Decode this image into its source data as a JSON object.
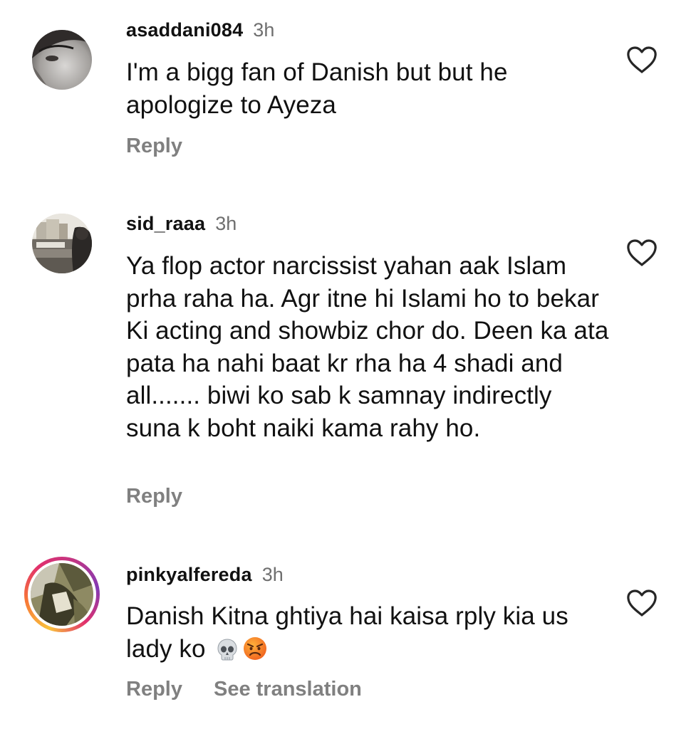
{
  "comments": [
    {
      "username": "asaddani084",
      "time": "3h",
      "text": "I'm a bigg fan of Danish but but he apologize to Ayeza",
      "reply_label": "Reply"
    },
    {
      "username": "sid_raaa",
      "time": "3h",
      "text": "Ya flop actor narcissist yahan aak Islam prha raha ha. Agr itne hi Islami ho to bekar Ki acting and showbiz chor do. Deen ka ata pata ha nahi baat kr rha ha 4 shadi and all....... biwi ko sab k samnay indirectly suna k boht naiki kama rahy ho.",
      "reply_label": "Reply"
    },
    {
      "username": "pinkyalfereda",
      "time": "3h",
      "text": "Danish Kitna ghtiya hai kaisa rply kia us lady ko",
      "emojis": [
        "skull-emoji",
        "angry-face-emoji"
      ],
      "reply_label": "Reply",
      "translation_label": "See translation",
      "has_story_ring": true
    }
  ],
  "icons": {
    "like": "heart-outline-icon"
  },
  "colors": {
    "text": "#111111",
    "secondary": "#808080",
    "story_ring": [
      "#f9c23c",
      "#f77737",
      "#e1306c",
      "#c13584",
      "#833ab4"
    ]
  }
}
